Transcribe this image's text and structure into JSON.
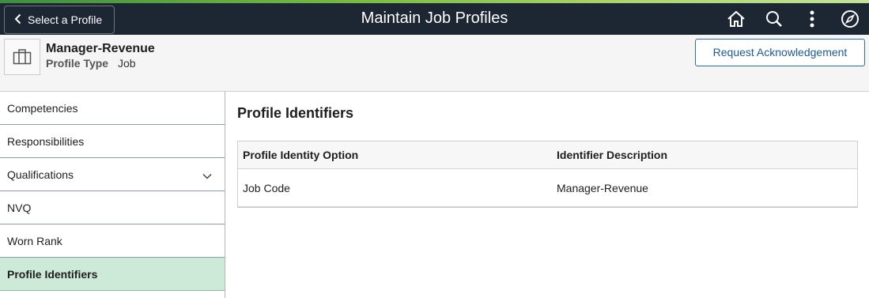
{
  "banner": {
    "back_label": "Select a Profile",
    "title": "Maintain Job Profiles",
    "icons": [
      "home-icon",
      "search-icon",
      "more-actions-icon",
      "navbar-compass-icon"
    ]
  },
  "header": {
    "profile_name": "Manager-Revenue",
    "profile_type_label": "Profile Type",
    "profile_type_value": "Job",
    "request_button": "Request Acknowledgement"
  },
  "sidebar": {
    "items": [
      {
        "label": "Competencies"
      },
      {
        "label": "Responsibilities"
      },
      {
        "label": "Qualifications"
      },
      {
        "label": "NVQ"
      },
      {
        "label": "Worn Rank"
      },
      {
        "label": "Profile Identifiers"
      }
    ]
  },
  "main": {
    "title": "Profile Identifiers",
    "grid": {
      "columns": [
        "Profile Identity Option",
        "Identifier Description"
      ],
      "rows": [
        [
          "Job Code",
          "Manager-Revenue"
        ]
      ]
    }
  },
  "colors": {
    "banner_bg": "#1d2633",
    "accent_green": "#76b943",
    "active_item_bg": "#cde9d8",
    "button_blue": "#2a6ebb"
  }
}
